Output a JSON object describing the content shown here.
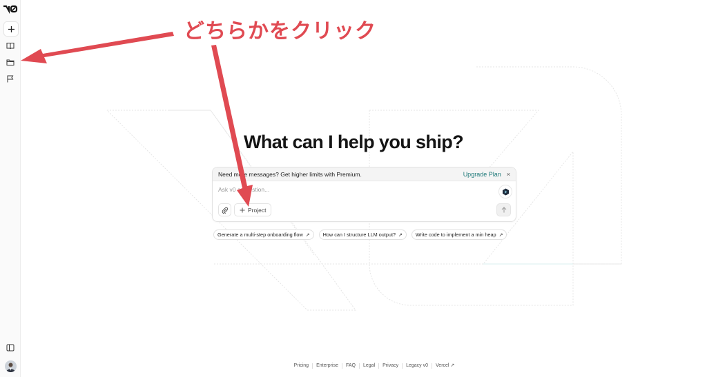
{
  "sidebar": {
    "logo_label": "v0",
    "icons": [
      "plus-icon",
      "book-icon",
      "folder-icon",
      "flag-icon",
      "panel-icon"
    ]
  },
  "main": {
    "headline": "What can I help you ship?",
    "banner": {
      "text": "Need more messages? Get higher limits with Premium.",
      "upgrade_label": "Upgrade Plan",
      "close_label": "×"
    },
    "prompt_placeholder": "Ask v0 a question...",
    "project_label": "Project",
    "suggestions": [
      "Generate a multi-step onboarding flow",
      "How can I structure LLM output?",
      "Write code to implement a min heap"
    ]
  },
  "footer": {
    "links": [
      "Pricing",
      "Enterprise",
      "FAQ",
      "Legal",
      "Privacy",
      "Legacy v0",
      "Vercel"
    ]
  },
  "annotation": {
    "text": "どちらかをクリック",
    "color": "#e04a52"
  }
}
